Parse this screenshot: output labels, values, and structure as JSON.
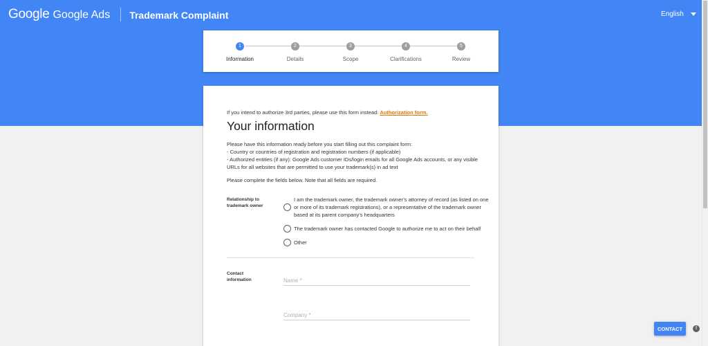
{
  "header": {
    "logo_google": "Google",
    "logo_ads": "Google Ads",
    "title": "Trademark Complaint",
    "language": "English"
  },
  "steps": [
    {
      "number": "1",
      "label": "Information",
      "active": true
    },
    {
      "number": "2",
      "label": "Details",
      "active": false
    },
    {
      "number": "3",
      "label": "Scope",
      "active": false
    },
    {
      "number": "4",
      "label": "Clarifications",
      "active": false
    },
    {
      "number": "5",
      "label": "Review",
      "active": false
    }
  ],
  "form": {
    "intro_text": "If you intend to authorize 3rd parties, please use this form instead: ",
    "intro_link": "Authorization form.",
    "heading": "Your information",
    "prep_lines": [
      "Please have this information ready before you start filling out this complaint form:",
      "- Country or countries of registration and registration numbers (if applicable)",
      "- Authorized entities (if any): Google Ads customer IDs/login emails for all Google Ads accounts, or any visible URLs for all websites that are permitted to use your trademark(s) in ad text"
    ],
    "required_note": "Please complete the fields below. Note that all fields are required.",
    "relationship": {
      "label": "Relationship to trademark owner",
      "options": [
        "I am the trademark owner, the trademark owner’s attorney of record (as listed on one or more of its trademark registrations), or a representative of the trademark owner based at its parent company’s headquarters",
        "The trademark owner has contacted Google to authorize me to act on their behalf",
        "Other"
      ]
    },
    "contact": {
      "label": "Contact information",
      "name_placeholder": "Name *",
      "name_value": "",
      "company_placeholder": "Company *",
      "company_value": ""
    }
  },
  "contact_button": "CONTACT",
  "colors": {
    "brand_blue": "#4285f4",
    "link_orange": "#e37400"
  }
}
